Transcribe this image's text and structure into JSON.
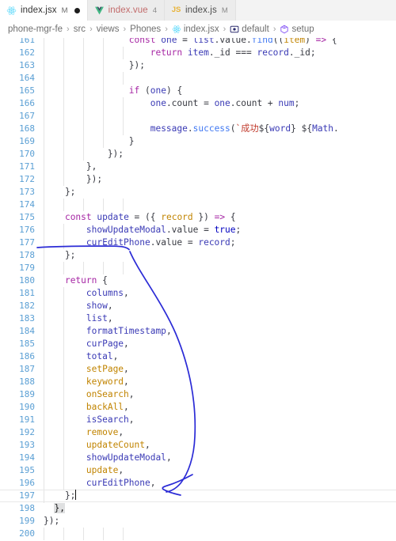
{
  "window": {
    "app": "vscode-editor",
    "accent_blue": "#3a3ab5",
    "annotation_color": "#2b2bd6"
  },
  "tabs": [
    {
      "label": "index.jsx",
      "badge": "M",
      "icon": "react-icon",
      "active": true,
      "dirty_dot": true
    },
    {
      "label": "index.vue",
      "badge": "4",
      "icon": "vue-icon",
      "active": false,
      "dirty_dot": false
    },
    {
      "label": "index.js",
      "badge": "M",
      "icon": "js-icon",
      "active": false,
      "dirty_dot": false
    }
  ],
  "breadcrumb": {
    "separator": "›",
    "items": [
      {
        "label": "phone-mgr-fe",
        "icon": ""
      },
      {
        "label": "src",
        "icon": ""
      },
      {
        "label": "views",
        "icon": ""
      },
      {
        "label": "Phones",
        "icon": ""
      },
      {
        "label": "index.jsx",
        "icon": "react-icon"
      },
      {
        "label": "default",
        "icon": "export-icon"
      },
      {
        "label": "setup",
        "icon": "symbol-icon"
      }
    ]
  },
  "editor": {
    "first_visible_line": 161,
    "cursor_line": 197,
    "lines": [
      {
        "n": 161,
        "indent": 0,
        "clipped": true,
        "tokens": [
          {
            "t": "                ",
            "c": "t-plain"
          },
          {
            "t": "const",
            "c": "t-key"
          },
          {
            "t": " ",
            "c": "t-plain"
          },
          {
            "t": "one",
            "c": "t-var"
          },
          {
            "t": " = ",
            "c": "t-plain"
          },
          {
            "t": "list",
            "c": "t-var"
          },
          {
            "t": ".value.",
            "c": "t-plain"
          },
          {
            "t": "find",
            "c": "t-meth"
          },
          {
            "t": "((",
            "c": "t-plain"
          },
          {
            "t": "item",
            "c": "t-fn"
          },
          {
            "t": ") ",
            "c": "t-plain"
          },
          {
            "t": "=>",
            "c": "t-key"
          },
          {
            "t": " {",
            "c": "t-plain"
          }
        ]
      },
      {
        "n": 162,
        "indent": 0,
        "tokens": [
          {
            "t": "                    ",
            "c": "t-plain"
          },
          {
            "t": "return",
            "c": "t-key"
          },
          {
            "t": " ",
            "c": "t-plain"
          },
          {
            "t": "item",
            "c": "t-var"
          },
          {
            "t": "._id === ",
            "c": "t-plain"
          },
          {
            "t": "record",
            "c": "t-var"
          },
          {
            "t": "._id;",
            "c": "t-plain"
          }
        ]
      },
      {
        "n": 163,
        "indent": 0,
        "tokens": [
          {
            "t": "                });",
            "c": "t-plain"
          }
        ]
      },
      {
        "n": 164,
        "indent": 0,
        "tokens": []
      },
      {
        "n": 165,
        "indent": 0,
        "tokens": [
          {
            "t": "                ",
            "c": "t-plain"
          },
          {
            "t": "if",
            "c": "t-key"
          },
          {
            "t": " (",
            "c": "t-plain"
          },
          {
            "t": "one",
            "c": "t-var"
          },
          {
            "t": ") {",
            "c": "t-plain"
          }
        ]
      },
      {
        "n": 166,
        "indent": 0,
        "tokens": [
          {
            "t": "                    ",
            "c": "t-plain"
          },
          {
            "t": "one",
            "c": "t-var"
          },
          {
            "t": ".count = ",
            "c": "t-plain"
          },
          {
            "t": "one",
            "c": "t-var"
          },
          {
            "t": ".count + ",
            "c": "t-plain"
          },
          {
            "t": "num",
            "c": "t-var"
          },
          {
            "t": ";",
            "c": "t-plain"
          }
        ]
      },
      {
        "n": 167,
        "indent": 0,
        "tokens": []
      },
      {
        "n": 168,
        "indent": 0,
        "clipped": true,
        "tokens": [
          {
            "t": "                    ",
            "c": "t-plain"
          },
          {
            "t": "message",
            "c": "t-var"
          },
          {
            "t": ".",
            "c": "t-plain"
          },
          {
            "t": "success",
            "c": "t-meth"
          },
          {
            "t": "(",
            "c": "t-plain"
          },
          {
            "t": "`成功",
            "c": "t-str"
          },
          {
            "t": "${",
            "c": "t-plain"
          },
          {
            "t": "word",
            "c": "t-var"
          },
          {
            "t": "}",
            "c": "t-plain"
          },
          {
            "t": " ",
            "c": "t-str"
          },
          {
            "t": "${",
            "c": "t-plain"
          },
          {
            "t": "Math",
            "c": "t-var"
          },
          {
            "t": ".",
            "c": "t-plain"
          }
        ]
      },
      {
        "n": 169,
        "indent": 0,
        "tokens": [
          {
            "t": "                }",
            "c": "t-plain"
          }
        ]
      },
      {
        "n": 170,
        "indent": 0,
        "tokens": [
          {
            "t": "            });",
            "c": "t-plain"
          }
        ]
      },
      {
        "n": 171,
        "indent": 0,
        "tokens": [
          {
            "t": "        },",
            "c": "t-plain"
          }
        ]
      },
      {
        "n": 172,
        "indent": 0,
        "tokens": [
          {
            "t": "        });",
            "c": "t-plain"
          }
        ]
      },
      {
        "n": 173,
        "indent": 0,
        "tokens": [
          {
            "t": "    };",
            "c": "t-plain"
          }
        ]
      },
      {
        "n": 174,
        "indent": 0,
        "tokens": []
      },
      {
        "n": 175,
        "indent": 0,
        "tokens": [
          {
            "t": "    ",
            "c": "t-plain"
          },
          {
            "t": "const",
            "c": "t-key"
          },
          {
            "t": " ",
            "c": "t-plain"
          },
          {
            "t": "update",
            "c": "t-var"
          },
          {
            "t": " = ({ ",
            "c": "t-plain"
          },
          {
            "t": "record",
            "c": "t-fn"
          },
          {
            "t": " }) ",
            "c": "t-plain"
          },
          {
            "t": "=>",
            "c": "t-key"
          },
          {
            "t": " {",
            "c": "t-plain"
          }
        ]
      },
      {
        "n": 176,
        "indent": 0,
        "tokens": [
          {
            "t": "        ",
            "c": "t-plain"
          },
          {
            "t": "showUpdateModal",
            "c": "t-var"
          },
          {
            "t": ".value = ",
            "c": "t-plain"
          },
          {
            "t": "true",
            "c": "t-kw2"
          },
          {
            "t": ";",
            "c": "t-plain"
          }
        ]
      },
      {
        "n": 177,
        "indent": 0,
        "tokens": [
          {
            "t": "        ",
            "c": "t-plain"
          },
          {
            "t": "curEditPhone",
            "c": "t-var"
          },
          {
            "t": ".value = ",
            "c": "t-plain"
          },
          {
            "t": "record",
            "c": "t-var"
          },
          {
            "t": ";",
            "c": "t-plain"
          }
        ]
      },
      {
        "n": 178,
        "indent": 0,
        "tokens": [
          {
            "t": "    };",
            "c": "t-plain"
          }
        ]
      },
      {
        "n": 179,
        "indent": 0,
        "tokens": []
      },
      {
        "n": 180,
        "indent": 0,
        "tokens": [
          {
            "t": "    ",
            "c": "t-plain"
          },
          {
            "t": "return",
            "c": "t-key"
          },
          {
            "t": " {",
            "c": "t-plain"
          }
        ]
      },
      {
        "n": 181,
        "indent": 0,
        "tokens": [
          {
            "t": "        ",
            "c": "t-plain"
          },
          {
            "t": "columns",
            "c": "t-var"
          },
          {
            "t": ",",
            "c": "t-plain"
          }
        ]
      },
      {
        "n": 182,
        "indent": 0,
        "tokens": [
          {
            "t": "        ",
            "c": "t-plain"
          },
          {
            "t": "show",
            "c": "t-var"
          },
          {
            "t": ",",
            "c": "t-plain"
          }
        ]
      },
      {
        "n": 183,
        "indent": 0,
        "tokens": [
          {
            "t": "        ",
            "c": "t-plain"
          },
          {
            "t": "list",
            "c": "t-var"
          },
          {
            "t": ",",
            "c": "t-plain"
          }
        ]
      },
      {
        "n": 184,
        "indent": 0,
        "tokens": [
          {
            "t": "        ",
            "c": "t-plain"
          },
          {
            "t": "formatTimestamp",
            "c": "t-var"
          },
          {
            "t": ",",
            "c": "t-plain"
          }
        ]
      },
      {
        "n": 185,
        "indent": 0,
        "tokens": [
          {
            "t": "        ",
            "c": "t-plain"
          },
          {
            "t": "curPage",
            "c": "t-var"
          },
          {
            "t": ",",
            "c": "t-plain"
          }
        ]
      },
      {
        "n": 186,
        "indent": 0,
        "tokens": [
          {
            "t": "        ",
            "c": "t-plain"
          },
          {
            "t": "total",
            "c": "t-var"
          },
          {
            "t": ",",
            "c": "t-plain"
          }
        ]
      },
      {
        "n": 187,
        "indent": 0,
        "tokens": [
          {
            "t": "        ",
            "c": "t-plain"
          },
          {
            "t": "setPage",
            "c": "t-fn"
          },
          {
            "t": ",",
            "c": "t-plain"
          }
        ]
      },
      {
        "n": 188,
        "indent": 0,
        "tokens": [
          {
            "t": "        ",
            "c": "t-plain"
          },
          {
            "t": "keyword",
            "c": "t-fn"
          },
          {
            "t": ",",
            "c": "t-plain"
          }
        ]
      },
      {
        "n": 189,
        "indent": 0,
        "tokens": [
          {
            "t": "        ",
            "c": "t-plain"
          },
          {
            "t": "onSearch",
            "c": "t-fn"
          },
          {
            "t": ",",
            "c": "t-plain"
          }
        ]
      },
      {
        "n": 190,
        "indent": 0,
        "tokens": [
          {
            "t": "        ",
            "c": "t-plain"
          },
          {
            "t": "backAll",
            "c": "t-fn"
          },
          {
            "t": ",",
            "c": "t-plain"
          }
        ]
      },
      {
        "n": 191,
        "indent": 0,
        "tokens": [
          {
            "t": "        ",
            "c": "t-plain"
          },
          {
            "t": "isSearch",
            "c": "t-var"
          },
          {
            "t": ",",
            "c": "t-plain"
          }
        ]
      },
      {
        "n": 192,
        "indent": 0,
        "tokens": [
          {
            "t": "        ",
            "c": "t-plain"
          },
          {
            "t": "remove",
            "c": "t-fn"
          },
          {
            "t": ",",
            "c": "t-plain"
          }
        ]
      },
      {
        "n": 193,
        "indent": 0,
        "tokens": [
          {
            "t": "        ",
            "c": "t-plain"
          },
          {
            "t": "updateCount",
            "c": "t-fn"
          },
          {
            "t": ",",
            "c": "t-plain"
          }
        ]
      },
      {
        "n": 194,
        "indent": 0,
        "tokens": [
          {
            "t": "        ",
            "c": "t-plain"
          },
          {
            "t": "showUpdateModal",
            "c": "t-var"
          },
          {
            "t": ",",
            "c": "t-plain"
          }
        ]
      },
      {
        "n": 195,
        "indent": 0,
        "tokens": [
          {
            "t": "        ",
            "c": "t-plain"
          },
          {
            "t": "update",
            "c": "t-fn"
          },
          {
            "t": ",",
            "c": "t-plain"
          }
        ]
      },
      {
        "n": 196,
        "indent": 0,
        "tokens": [
          {
            "t": "        ",
            "c": "t-plain"
          },
          {
            "t": "curEditPhone",
            "c": "t-var"
          },
          {
            "t": ",",
            "c": "t-plain"
          }
        ]
      },
      {
        "n": 197,
        "indent": 0,
        "current": true,
        "cursor_after": "    };",
        "tokens": [
          {
            "t": "    };",
            "c": "t-plain"
          }
        ]
      },
      {
        "n": 198,
        "indent": 0,
        "bracket_match": true,
        "tokens": [
          {
            "t": "  ",
            "c": "t-plain"
          },
          {
            "t": "},",
            "c": "t-plain"
          }
        ]
      },
      {
        "n": 199,
        "indent": 0,
        "tokens": [
          {
            "t": "});",
            "c": "t-plain"
          }
        ]
      },
      {
        "n": 200,
        "indent": 0,
        "tokens": []
      }
    ]
  },
  "annotation": {
    "type": "freehand-ink",
    "color": "#2b2bd6",
    "description": "underline under curEditPhone.value on line 177 with a curved arrow pointing down to curEditPhone on line 196"
  }
}
